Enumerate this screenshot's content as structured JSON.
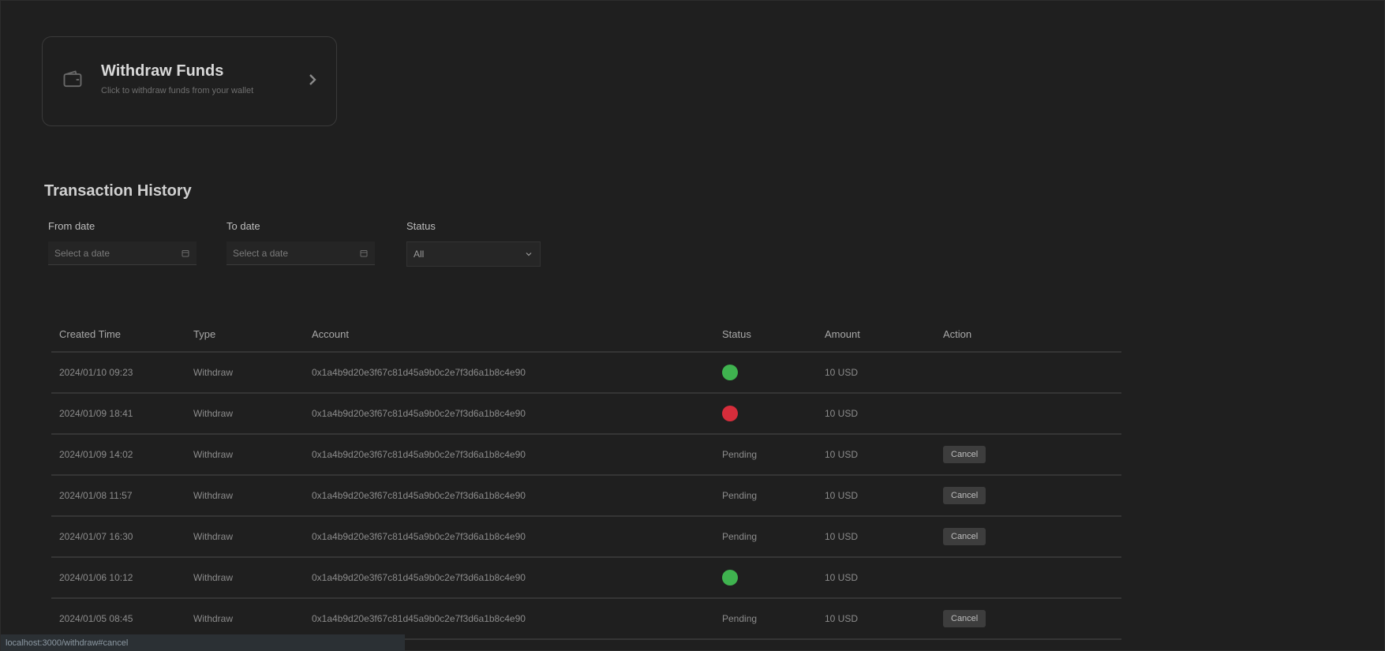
{
  "withdraw_card": {
    "title": "Withdraw Funds",
    "subtitle": "Click to withdraw funds from your wallet",
    "icon": "wallet-icon",
    "arrow_icon": "chevron-right-icon"
  },
  "history": {
    "title": "Transaction History",
    "filters": {
      "from_label": "From date",
      "from_placeholder": "Select a date",
      "to_label": "To date",
      "to_placeholder": "Select a date",
      "status_label": "Status",
      "status_value": "All"
    },
    "columns": [
      "Created Time",
      "Type",
      "Account",
      "Status",
      "Amount",
      "Action"
    ],
    "rows": [
      {
        "time": "2024/01/10 09:23",
        "type": "Withdraw",
        "account": "0x1a4b9d20e3f67c81d45a9b0c2e7f3d6a1b8c4e90",
        "status": "success",
        "amount": "10 USD",
        "action": ""
      },
      {
        "time": "2024/01/09 18:41",
        "type": "Withdraw",
        "account": "0x1a4b9d20e3f67c81d45a9b0c2e7f3d6a1b8c4e90",
        "status": "failed",
        "amount": "10 USD",
        "action": ""
      },
      {
        "time": "2024/01/09 14:02",
        "type": "Withdraw",
        "account": "0x1a4b9d20e3f67c81d45a9b0c2e7f3d6a1b8c4e90",
        "status": "Pending",
        "amount": "10 USD",
        "action": "Cancel"
      },
      {
        "time": "2024/01/08 11:57",
        "type": "Withdraw",
        "account": "0x1a4b9d20e3f67c81d45a9b0c2e7f3d6a1b8c4e90",
        "status": "Pending",
        "amount": "10 USD",
        "action": "Cancel"
      },
      {
        "time": "2024/01/07 16:30",
        "type": "Withdraw",
        "account": "0x1a4b9d20e3f67c81d45a9b0c2e7f3d6a1b8c4e90",
        "status": "Pending",
        "amount": "10 USD",
        "action": "Cancel"
      },
      {
        "time": "2024/01/06 10:12",
        "type": "Withdraw",
        "account": "0x1a4b9d20e3f67c81d45a9b0c2e7f3d6a1b8c4e90",
        "status": "success",
        "amount": "10 USD",
        "action": ""
      },
      {
        "time": "2024/01/05 08:45",
        "type": "Withdraw",
        "account": "0x1a4b9d20e3f67c81d45a9b0c2e7f3d6a1b8c4e90",
        "status": "Pending",
        "amount": "10 USD",
        "action": "Cancel"
      }
    ]
  },
  "status_colors": {
    "success": "#3fb34f",
    "failed": "#d62d3b"
  },
  "status_bar": {
    "text": "localhost:3000/withdraw#cancel"
  }
}
